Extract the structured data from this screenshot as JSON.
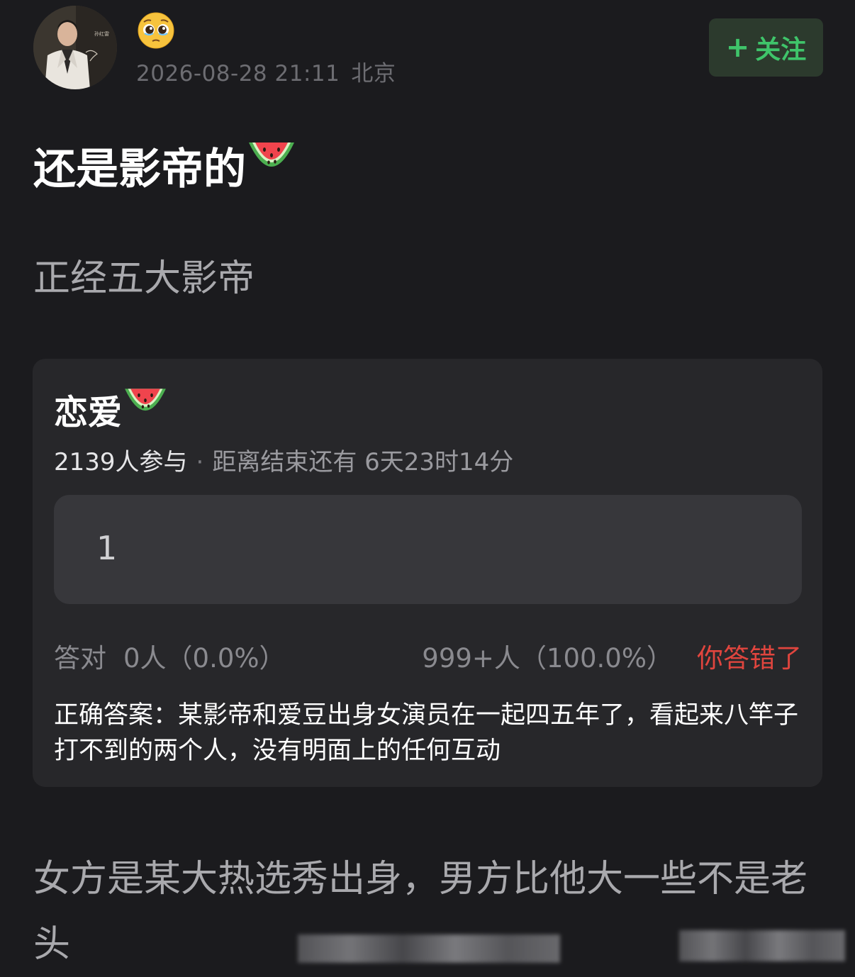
{
  "header": {
    "date": "2026-08-28 21:11",
    "location": "北京",
    "emoji": "pleading-face",
    "avatar_caption": "孙红雷",
    "follow_icon": "+",
    "follow_label": "关注",
    "follow_color": "#3fc46a"
  },
  "post": {
    "title": "还是影帝的",
    "title_emoji": "watermelon",
    "subtitle": "正经五大影帝"
  },
  "quiz": {
    "title": "恋爱",
    "title_emoji": "watermelon",
    "participants": "2139人参与",
    "separator": "·",
    "countdown": "距离结束还有 6天23时14分",
    "option_text": "1",
    "correct_label": "答对",
    "correct_value": "0人（0.0%）",
    "option_stats": "999+人（100.0%）",
    "result_text": "你答错了",
    "result_color": "#e0453e",
    "answer": "正确答案：某影帝和爱豆出身女演员在一起四五年了，看起来八竿子打不到的两个人，没有明面上的任何互动"
  },
  "body": {
    "text": "女方是某大热选秀出身，男方比他大一些不是老头"
  }
}
